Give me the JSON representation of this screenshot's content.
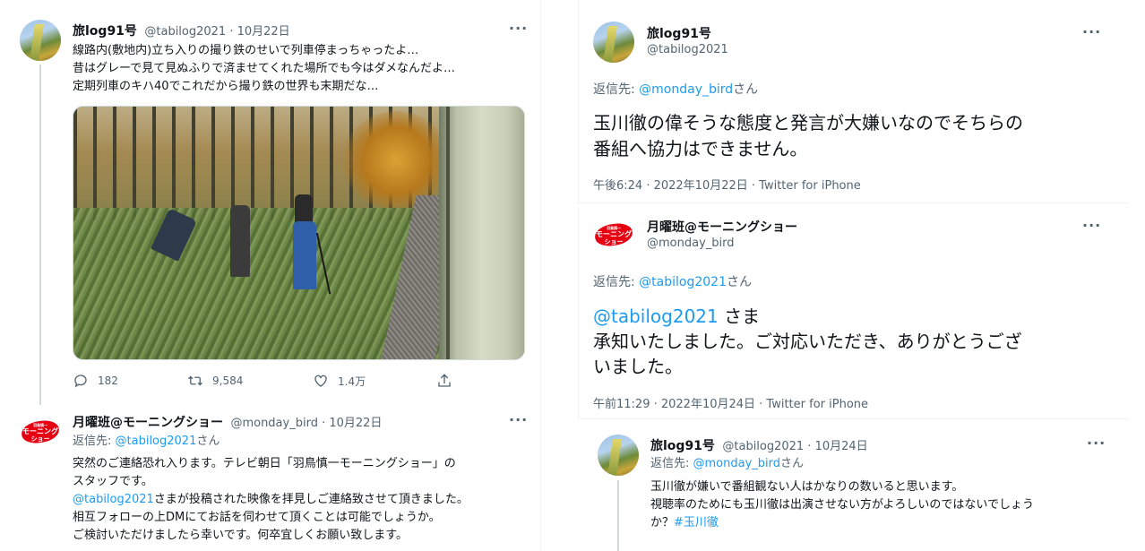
{
  "left_col": {
    "tweet1": {
      "name": "旅log91号",
      "handle_time": "@tabilog2021 · 10月22日",
      "lines": [
        "線路内(敷地内)立ち入りの撮り鉄のせいで列車停まっちゃったよ…",
        "昔はグレーで見て見ぬふりで済ませてくれた場所でも今はダメなんだよ…",
        "定期列車のキハ40でこれだから撮り鉄の世界も末期だな…"
      ],
      "reply_count": "182",
      "retweet_count": "9,584",
      "like_count": "1.4万"
    },
    "tweet2": {
      "name": "月曜班@モーニングショー",
      "handle_time": "@monday_bird · 10月22日",
      "reply_prefix": "返信先: ",
      "reply_to": "@tabilog2021",
      "reply_suffix": "さん",
      "line1": "突然のご連絡恐れ入ります。テレビ朝日「羽鳥慎一モーニングショー」の",
      "line2": "スタッフです。",
      "line3_mention": "@tabilog2021",
      "line3_rest": "さまが投稿された映像を拝見しご連絡致させて頂きました。",
      "line4": "相互フォローの上DMにてお話を伺わせて頂くことは可能でしょうか。",
      "line5": "ご検討いただけましたら幸いです。何卒宜しくお願い致します。"
    }
  },
  "right_col": {
    "tweet3": {
      "name": "旅log91号",
      "handle": "@tabilog2021",
      "reply_prefix": "返信先: ",
      "reply_to": "@monday_bird",
      "reply_suffix": "さん",
      "line1": "玉川徹の偉そうな態度と発言が大嫌いなのでそちらの",
      "line2": "番組へ協力はできません。",
      "meta": "午後6:24 · 2022年10月22日 · Twitter for iPhone"
    },
    "tweet4": {
      "name": "月曜班@モーニングショー",
      "handle": "@monday_bird",
      "reply_prefix": "返信先: ",
      "reply_to": "@tabilog2021",
      "reply_suffix": "さん",
      "mention": "@tabilog2021",
      "mention_suffix": " さま",
      "line2": "承知いたしました。ご対応いただき、ありがとうござ",
      "line3": "いました。",
      "meta": "午前11:29 · 2022年10月24日 · Twitter for iPhone"
    },
    "tweet5": {
      "name": "旅log91号",
      "handle_time": "@tabilog2021 · 10月24日",
      "reply_prefix": "返信先: ",
      "reply_to": "@monday_bird",
      "reply_suffix": "さん",
      "line1": "玉川徹が嫌いで番組観ない人はかなりの数いると思います。",
      "line2": "視聴率のためにも玉川徹は出演させない方がよろしいのではないでしょう",
      "line3_prefix": "か？",
      "hashtag": "#玉川徹"
    }
  },
  "logo_text": {
    "top": "羽鳥慎一",
    "mid": "モーニング",
    "bot": "ショー"
  },
  "colors": {
    "link": "#1d9bf0",
    "muted": "#536471",
    "text": "#0f1419",
    "brand_red": "#e60012"
  },
  "icons": [
    "more-icon",
    "reply-icon",
    "retweet-icon",
    "like-icon",
    "share-icon"
  ]
}
